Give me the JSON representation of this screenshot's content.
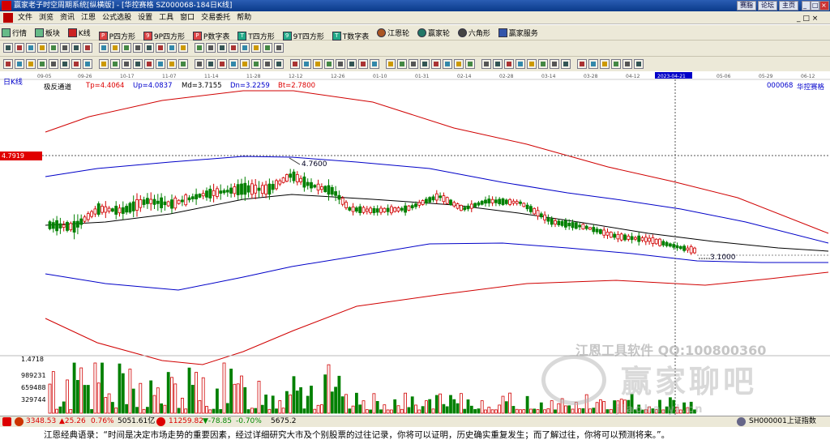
{
  "window": {
    "title": "赢家老子时空周期系统[纵横版] - [华控赛格   SZ000068-184日K线]",
    "buttons": [
      "赛脂",
      "论坛",
      "主页"
    ],
    "controls": [
      "_",
      "□",
      "×"
    ],
    "sub_controls": [
      "_",
      "□",
      "×"
    ]
  },
  "menu": [
    "文件",
    "浏览",
    "资讯",
    "江恩",
    "公式选股",
    "设置",
    "工具",
    "窗口",
    "交易委托",
    "帮助"
  ],
  "toolbar1": [
    {
      "label": "行情",
      "icon": "table-icon"
    },
    {
      "label": "板块",
      "icon": "grid-icon"
    },
    {
      "label": "K线",
      "icon": "candle-icon"
    },
    {
      "label": "P四方形",
      "icon": "P"
    },
    {
      "label": "9P四方形",
      "icon": "9P"
    },
    {
      "label": "P数字表",
      "icon": "P"
    },
    {
      "label": "T四方形",
      "icon": "T"
    },
    {
      "label": "9T四方形",
      "icon": "9T"
    },
    {
      "label": "T数字表",
      "icon": "TN"
    },
    {
      "label": "江恩轮",
      "icon": "wheel-icon"
    },
    {
      "label": "赢家轮",
      "icon": "wheel-icon"
    },
    {
      "label": "六角形",
      "icon": "hexagon-icon"
    },
    {
      "label": "赢家服务",
      "icon": "service-icon"
    }
  ],
  "chart": {
    "period_label": "日K线",
    "indicator_name": "极反通道",
    "indicator_values": [
      {
        "text": "Tp=4.4064",
        "color": "#d00000"
      },
      {
        "text": "Up=4.0837",
        "color": "#0000c8"
      },
      {
        "text": "Md=3.7155",
        "color": "#000000"
      },
      {
        "text": "Dn=3.2259",
        "color": "#0000c8"
      },
      {
        "text": "Bt=2.7800",
        "color": "#d00000"
      }
    ],
    "stock_code": "000068",
    "stock_name": "华控赛格",
    "dates": [
      "09-05",
      "09-26",
      "10-17",
      "11-07",
      "11-14",
      "11-28",
      "12-12",
      "12-26",
      "01-10",
      "01-31",
      "02-14",
      "02-28",
      "03-14",
      "03-28",
      "04-12",
      "2023-04-21",
      "05-06",
      "05-29",
      "06-12"
    ],
    "price_marker": "4.7919",
    "high_label": "4.7600",
    "low_label": "3.1000",
    "volume_ticks": [
      "1.4718",
      "989231",
      "659488",
      "329744"
    ],
    "watermark": {
      "line1": "江恩工具软件  QQ:100800360",
      "line2": "赢家聊吧",
      "line3": "jiaoba.yi.cn"
    },
    "colors": {
      "up": "#d00000",
      "down": "#008000",
      "outer_band": "#d00000",
      "inner_band": "#0000c8",
      "middle": "#000000"
    }
  },
  "status": {
    "idx1": "3348.53",
    "idx1_chg": "▲25.26",
    "idx1_pct": "0.76%",
    "idx1_amt": "5051.61亿",
    "idx2": "11259.82",
    "idx2_chg": "▼-78.85",
    "idx2_pct": "-0.70%",
    "idx2_amt": "5675.2",
    "right": "SH000001上证指数"
  },
  "quote": "江恩经典语录：“时间是决定市场走势的重要因素，经过详细研究大市及个别股票的过往记录，你将可以证明，历史确实重复发生；而了解过往，你将可以预测将来。”。"
}
